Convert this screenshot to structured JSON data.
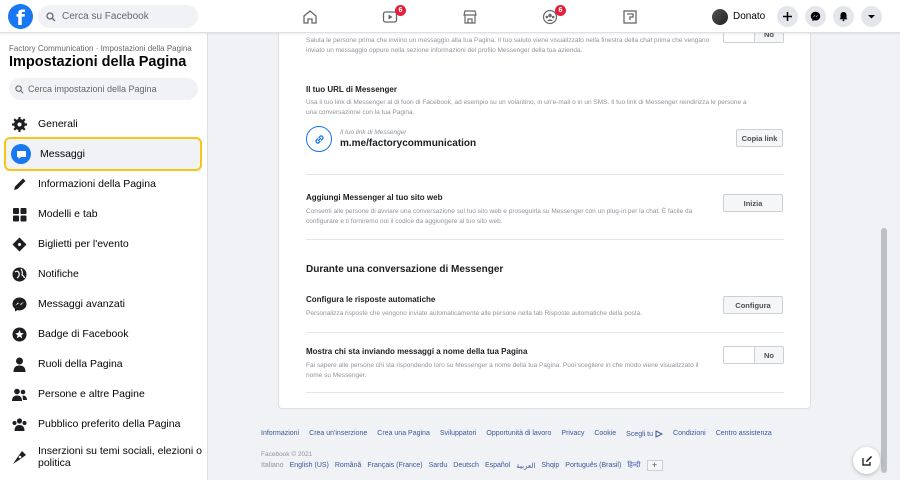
{
  "topbar": {
    "search_placeholder": "Cerca su Facebook",
    "logo_letter": "f",
    "nav": [
      {
        "name": "home-icon",
        "badge": ""
      },
      {
        "name": "watch-icon",
        "badge": "6"
      },
      {
        "name": "marketplace-icon",
        "badge": ""
      },
      {
        "name": "groups-icon",
        "badge": "6"
      },
      {
        "name": "gaming-icon",
        "badge": ""
      }
    ],
    "profile_name": "Donato"
  },
  "sidebar": {
    "breadcrumb": "Factory Communication · Impostazioni della Pagina",
    "title": "Impostazioni della Pagina",
    "search_placeholder": "Cerca impostazioni della Pagina",
    "items": [
      {
        "label": "Generali",
        "icon": "gear-icon"
      },
      {
        "label": "Messaggi",
        "icon": "messages-icon",
        "active": true
      },
      {
        "label": "Informazioni della Pagina",
        "icon": "pencil-icon"
      },
      {
        "label": "Modelli e tab",
        "icon": "grid-icon"
      },
      {
        "label": "Biglietti per l'evento",
        "icon": "ticket-icon"
      },
      {
        "label": "Notifiche",
        "icon": "globe-icon"
      },
      {
        "label": "Messaggi avanzati",
        "icon": "messenger-icon"
      },
      {
        "label": "Badge di Facebook",
        "icon": "badge-icon"
      },
      {
        "label": "Ruoli della Pagina",
        "icon": "person-icon"
      },
      {
        "label": "Persone e altre Pagine",
        "icon": "people-icon"
      },
      {
        "label": "Pubblico preferito della Pagina",
        "icon": "audience-icon"
      },
      {
        "label": "Inserzioni su temi sociali, elezioni o politica",
        "icon": "pen-nib-icon"
      }
    ]
  },
  "main": {
    "greeting_desc": "Saluta le persone prima che inviino un messaggio alla tua Pagina. Il tuo saluto viene visualizzato nella finestra della chat prima che vengano inviato un messaggio oppure nella sezione informazioni del profilo Messenger della tua azienda.",
    "url_title": "Il tuo URL di Messenger",
    "url_desc": "Usa il tuo link di Messenger al di fuori di Facebook, ad esempio su un volantino, in un'e-mail o in un SMS. Il tuo link di Messenger reindirizza le persone a una conversazione con la tua Pagina.",
    "link_label": "Il tuo link di Messenger",
    "link_value": "m.me/factorycommunication",
    "copy_link": "Copia link",
    "website_title": "Aggiungi Messenger al tuo sito web",
    "website_desc": "Consenti alle persone di avviare una conversazione sul tuo sito web e proseguirla su Messenger con un plug-in per la chat. È facile da configurare e ti forniremo noi il codice da aggiungere al tuo sito web.",
    "start_btn": "Inizia",
    "conversation_heading": "Durante una conversazione di Messenger",
    "auto_title": "Configura le risposte automatiche",
    "auto_desc": "Personalizza risposte che vengono inviate automaticamente alle persone nella tab Risposte automatiche della posta.",
    "configure_btn": "Configura",
    "sender_title": "Mostra chi sta inviando messaggi a nome della tua Pagina",
    "sender_desc": "Fai sapere alle persone chi sta rispondendo loro su Messenger a nome della tua Pagina. Puoi scegliere in che modo viene visualizzato il nome su Messenger.",
    "toggle_top_label": "No",
    "toggle_label": "No"
  },
  "footer": {
    "links": [
      "Informazioni",
      "Crea un'inserzione",
      "Crea una Pagina",
      "Sviluppatori",
      "Opportunità di lavoro",
      "Privacy",
      "Cookie",
      "Scegli tu",
      "Condizioni",
      "Centro assistenza"
    ],
    "copyright": "Facebook © 2021",
    "current_lang": "Italiano",
    "languages": [
      "English (US)",
      "Română",
      "Français (France)",
      "Sardu",
      "Deutsch",
      "Español",
      "العربية",
      "Shqip",
      "Português (Brasil)",
      "हिन्दी"
    ],
    "more_langs": "+"
  },
  "colors": {
    "brand": "#1877f2",
    "badge": "#e41e3f",
    "highlight": "#f5c518"
  }
}
